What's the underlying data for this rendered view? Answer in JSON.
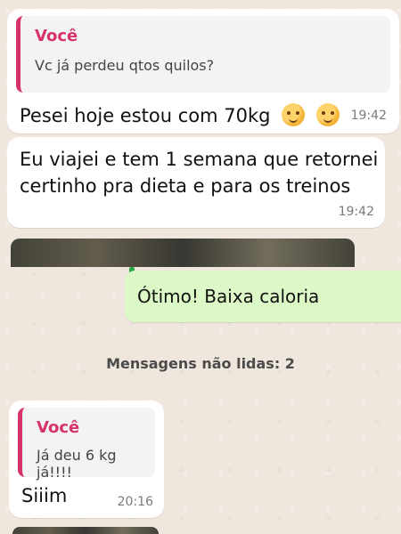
{
  "chat": {
    "messages": [
      {
        "quoted_author": "Você",
        "quoted_text": "Vc já perdeu qtos quilos?",
        "text": "Pesei hoje estou com 70kg",
        "emojis": [
          "smiling-face-with-hand-over-mouth",
          "smiling-face-with-hand-over-mouth"
        ],
        "time": "19:42"
      },
      {
        "text": "Eu viajei e tem 1 semana que retornei certinho pra dieta e para os treinos",
        "time": "19:42"
      },
      {
        "text": "Ótimo! Baixa caloria"
      }
    ],
    "unread_label": "Mensagens não lidas: 2",
    "last": {
      "quoted_author": "Você",
      "quoted_text": "Já deu 6 kg já!!!!",
      "text": "Siiim",
      "time": "20:16"
    }
  },
  "colors": {
    "wallpaper": "#efe7dd",
    "incoming_bubble": "#ffffff",
    "outgoing_bubble": "#dcf8c6",
    "quote_accent": "#d6336c",
    "reply_accent": "#28a745"
  }
}
